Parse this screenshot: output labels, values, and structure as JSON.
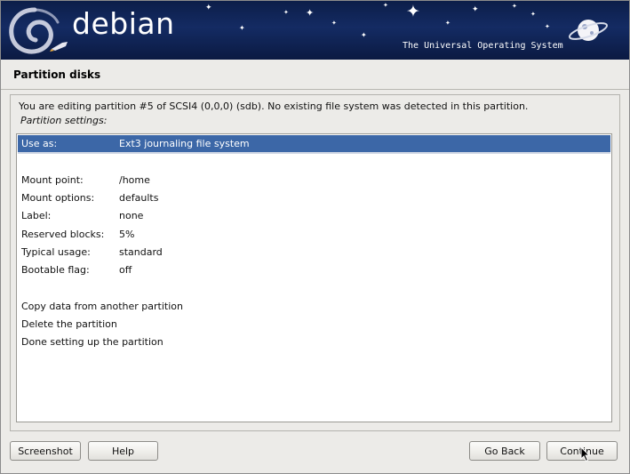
{
  "banner": {
    "brand": "debian",
    "tagline": "The Universal Operating System"
  },
  "page": {
    "title": "Partition disks"
  },
  "main": {
    "info": "You are editing partition #5 of SCSI4 (0,0,0) (sdb). No existing file system was detected in this partition.",
    "settings_label": "Partition settings:",
    "rows": [
      {
        "key": "Use as:",
        "value": "Ext3 journaling file system",
        "selected": true
      },
      {
        "key": "Mount point:",
        "value": "/home"
      },
      {
        "key": "Mount options:",
        "value": "defaults"
      },
      {
        "key": "Label:",
        "value": "none"
      },
      {
        "key": "Reserved blocks:",
        "value": "5%"
      },
      {
        "key": "Typical usage:",
        "value": "standard"
      },
      {
        "key": "Bootable flag:",
        "value": "off"
      },
      {
        "key": "Copy data from another partition"
      },
      {
        "key": "Delete the partition"
      },
      {
        "key": "Done setting up the partition"
      }
    ]
  },
  "buttons": {
    "screenshot": "Screenshot",
    "help": "Help",
    "go_back": "Go Back",
    "continue": "Continue"
  },
  "colors": {
    "banner": "#142b63",
    "selection": "#3c67a7",
    "background": "#ecebe8"
  }
}
